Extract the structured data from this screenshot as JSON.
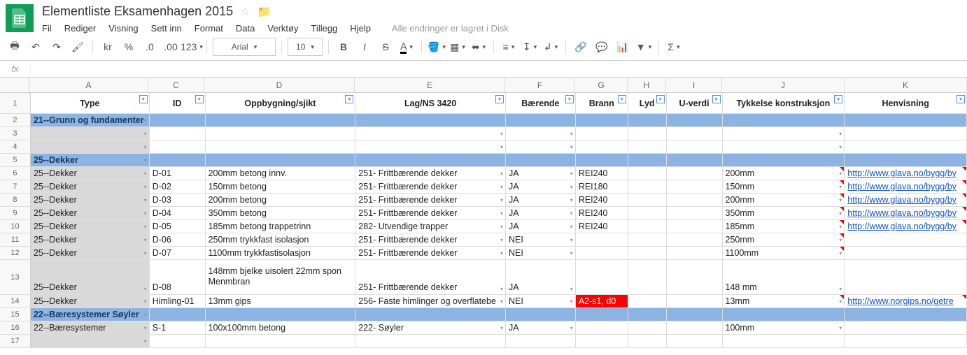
{
  "doc_title": "Elementliste Eksamenhagen 2015",
  "save_status": "Alle endringer er lagret i Disk",
  "menu": [
    "Fil",
    "Rediger",
    "Visning",
    "Sett inn",
    "Format",
    "Data",
    "Verktøy",
    "Tillegg",
    "Hjelp"
  ],
  "toolbar": {
    "font": "Arial",
    "font_size": "10",
    "more_fmt": "123",
    "currency": "kr",
    "percent": "%"
  },
  "fx_label": "fx",
  "columns": [
    {
      "letter": "A",
      "label": "Type",
      "class": "col-A"
    },
    {
      "letter": "C",
      "label": "ID",
      "class": "col-C"
    },
    {
      "letter": "D",
      "label": "Oppbygning/sjikt",
      "class": "col-D"
    },
    {
      "letter": "E",
      "label": "Lag/NS 3420",
      "class": "col-E"
    },
    {
      "letter": "F",
      "label": "Bærende",
      "class": "col-F"
    },
    {
      "letter": "G",
      "label": "Brann",
      "class": "col-G"
    },
    {
      "letter": "H",
      "label": "Lyd",
      "class": "col-H"
    },
    {
      "letter": "I",
      "label": "U-verdi",
      "class": "col-I"
    },
    {
      "letter": "J",
      "label": "Tykkelse konstruksjon",
      "class": "col-J"
    },
    {
      "letter": "K",
      "label": "Henvisning",
      "class": "col-K"
    }
  ],
  "row_numbers": [
    "1",
    "2",
    "3",
    "4",
    "5",
    "6",
    "7",
    "8",
    "9",
    "10",
    "11",
    "12",
    "13",
    "14",
    "15",
    "16",
    "17"
  ],
  "section1": "21--Grunn og fundamenter",
  "section2": "25--Dekker",
  "section3": "22--Bæresystemer Søyler",
  "rows": {
    "r6": {
      "A": "25--Dekker",
      "C": "D-01",
      "D": "200mm betong innv.",
      "E": "251- Frittbærende dekker",
      "F": "JA",
      "G": "REI240",
      "J": "200mm",
      "K": "http://www.glava.no/bygg/by"
    },
    "r7": {
      "A": "25--Dekker",
      "C": "D-02",
      "D": "150mm betong",
      "E": "251- Frittbærende dekker",
      "F": "JA",
      "G": "REI180",
      "J": "150mm",
      "K": "http://www.glava.no/bygg/by"
    },
    "r8": {
      "A": "25--Dekker",
      "C": "D-03",
      "D": "200mm betong",
      "E": "251- Frittbærende dekker",
      "F": "JA",
      "G": "REI240",
      "J": "200mm",
      "K": "http://www.glava.no/bygg/by"
    },
    "r9": {
      "A": "25--Dekker",
      "C": "D-04",
      "D": "350mm betong",
      "E": "251- Frittbærende dekker",
      "F": "JA",
      "G": "REI240",
      "J": "350mm",
      "K": "http://www.glava.no/bygg/by"
    },
    "r10": {
      "A": "25--Dekker",
      "C": "D-05",
      "D": "185mm betong trappetrinn",
      "E": "282- Utvendige trapper",
      "F": "JA",
      "G": "REI240",
      "J": "185mm",
      "K": "http://www.glava.no/bygg/by"
    },
    "r11": {
      "A": "25--Dekker",
      "C": "D-06",
      "D": "250mm trykkfast isolasjon",
      "E": "251- Frittbærende dekker",
      "F": "NEI",
      "G": "",
      "J": "250mm",
      "K": ""
    },
    "r12": {
      "A": "25--Dekker",
      "C": "D-07",
      "D": "1100mm trykkfastisolasjon",
      "E": "251- Frittbærende dekker",
      "F": "NEI",
      "G": "",
      "J": "1100mm",
      "K": ""
    },
    "r13": {
      "A": "25--Dekker",
      "C": "D-08",
      "D": "148mm bjelke uisolert\n22mm spon\nMenmbran",
      "E": "251- Frittbærende dekker",
      "F": "JA",
      "G": "",
      "J": "148 mm",
      "K": ""
    },
    "r14": {
      "A": "25--Dekker",
      "C": "Himling-01",
      "D": "13mm gips",
      "E": "256- Faste himlinger og overflatebe",
      "F": "NEI",
      "G": "A2-s1, d0",
      "J": "13mm",
      "K": "http://www.norgips.no/getre"
    },
    "r16": {
      "A": "22--Bæresystemer",
      "C": "S-1",
      "D": "100x100mm betong",
      "E": "222- Søyler",
      "F": "JA",
      "G": "",
      "J": "100mm",
      "K": ""
    }
  }
}
